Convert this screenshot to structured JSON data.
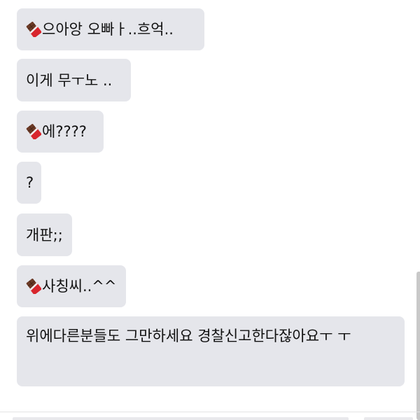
{
  "messages": [
    {
      "emoji": "chocolate-bar-icon",
      "text": "으아앙 오빠ㅏ..흐억.."
    },
    {
      "emoji": "",
      "text": "이게 무ㅜ노 .."
    },
    {
      "emoji": "chocolate-bar-icon",
      "text": "에????"
    },
    {
      "emoji": "",
      "text": "?"
    },
    {
      "emoji": "",
      "text": "개판;;"
    },
    {
      "emoji": "chocolate-bar-icon",
      "text": "사칭씨..^^"
    },
    {
      "emoji": "",
      "text": "위에다른분들도 그만하세요 경찰신고한다잖아요ㅜ ㅜ"
    }
  ],
  "colors": {
    "bubble_bg": "#e5e6eb",
    "text": "#111111",
    "chocolate_wrapper": "#d8262d",
    "chocolate": "#6b3a26"
  }
}
